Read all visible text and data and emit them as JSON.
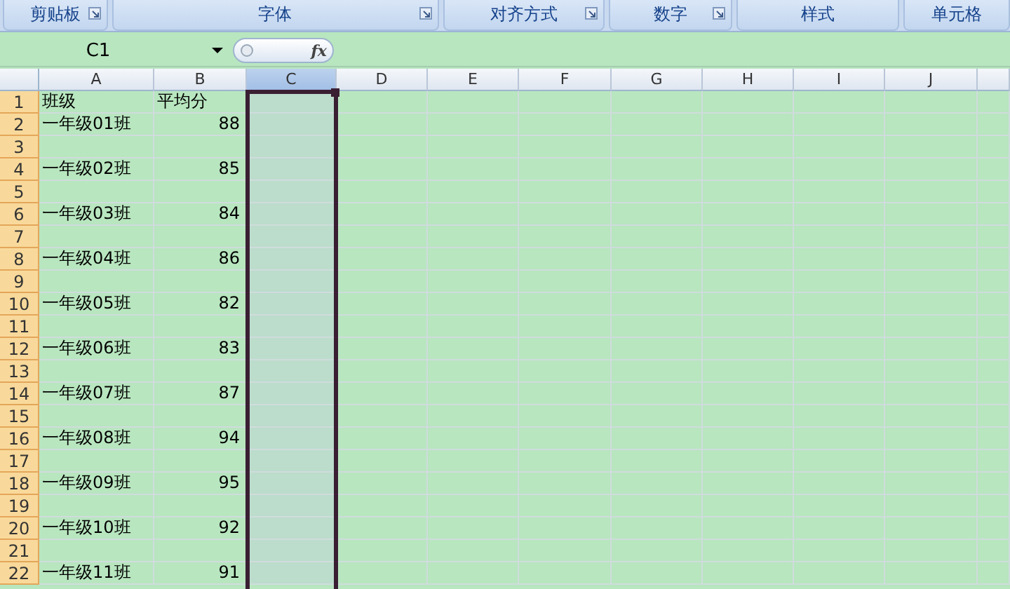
{
  "ribbon_groups": [
    {
      "label": "剪贴板",
      "launcher": true
    },
    {
      "label": "字体",
      "launcher": true
    },
    {
      "label": "对齐方式",
      "launcher": true
    },
    {
      "label": "数字",
      "launcher": true
    },
    {
      "label": "样式",
      "launcher": false
    },
    {
      "label": "单元格",
      "launcher": false
    }
  ],
  "formula_bar": {
    "name_box": "C1",
    "function_label": "fx"
  },
  "columns": [
    {
      "label": "A",
      "selected": false
    },
    {
      "label": "B",
      "selected": false
    },
    {
      "label": "C",
      "selected": true
    },
    {
      "label": "D",
      "selected": false
    },
    {
      "label": "E",
      "selected": false
    },
    {
      "label": "F",
      "selected": false
    },
    {
      "label": "G",
      "selected": false
    },
    {
      "label": "H",
      "selected": false
    },
    {
      "label": "I",
      "selected": false
    },
    {
      "label": "J",
      "selected": false
    }
  ],
  "rows": [
    {
      "number": "1",
      "cells": [
        "班级",
        "平均分"
      ]
    },
    {
      "number": "2",
      "cells": [
        "一年级01班",
        "88"
      ]
    },
    {
      "number": "3",
      "cells": []
    },
    {
      "number": "4",
      "cells": [
        "一年级02班",
        "85"
      ]
    },
    {
      "number": "5",
      "cells": []
    },
    {
      "number": "6",
      "cells": [
        "一年级03班",
        "84"
      ]
    },
    {
      "number": "7",
      "cells": []
    },
    {
      "number": "8",
      "cells": [
        "一年级04班",
        "86"
      ]
    },
    {
      "number": "9",
      "cells": []
    },
    {
      "number": "10",
      "cells": [
        "一年级05班",
        "82"
      ]
    },
    {
      "number": "11",
      "cells": []
    },
    {
      "number": "12",
      "cells": [
        "一年级06班",
        "83"
      ]
    },
    {
      "number": "13",
      "cells": []
    },
    {
      "number": "14",
      "cells": [
        "一年级07班",
        "87"
      ]
    },
    {
      "number": "15",
      "cells": []
    },
    {
      "number": "16",
      "cells": [
        "一年级08班",
        "94"
      ]
    },
    {
      "number": "17",
      "cells": []
    },
    {
      "number": "18",
      "cells": [
        "一年级09班",
        "95"
      ]
    },
    {
      "number": "19",
      "cells": []
    },
    {
      "number": "20",
      "cells": [
        "一年级10班",
        "92"
      ]
    },
    {
      "number": "21",
      "cells": []
    },
    {
      "number": "22",
      "cells": [
        "一年级11班",
        "91"
      ]
    }
  ]
}
